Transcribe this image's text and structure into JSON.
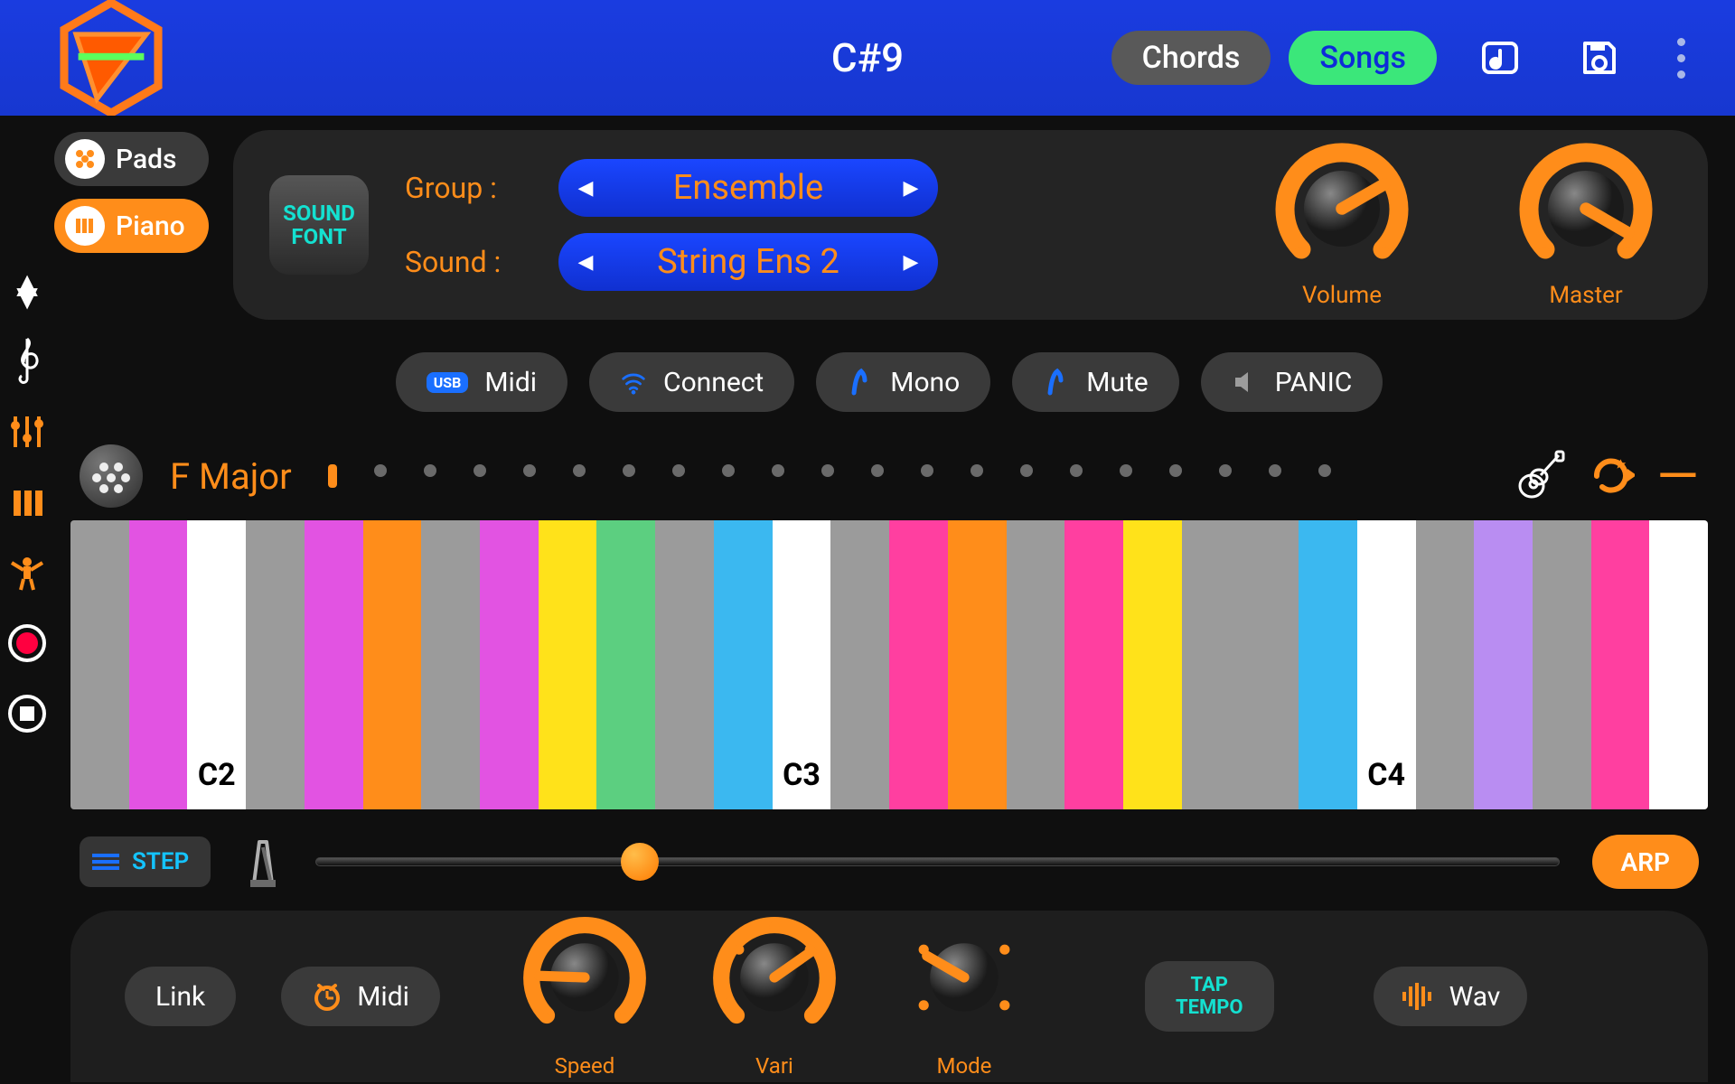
{
  "header": {
    "title": "C#9",
    "chords_label": "Chords",
    "songs_label": "Songs"
  },
  "instrument_tabs": {
    "pads": "Pads",
    "piano": "Piano"
  },
  "sound": {
    "font_button": "SOUND FONT",
    "group_label": "Group :",
    "group_value": "Ensemble",
    "sound_label": "Sound :",
    "sound_value": "String Ens 2",
    "volume_label": "Volume",
    "master_label": "Master",
    "volume_angle": 60,
    "master_angle": 120
  },
  "actions": {
    "midi": "Midi",
    "connect": "Connect",
    "mono": "Mono",
    "mute": "Mute",
    "panic": "PANIC"
  },
  "scale": {
    "name": "F Major",
    "dot_count": 21,
    "key_labels": {
      "2": "C2",
      "12": "C3",
      "22": "C4"
    },
    "key_colors": [
      "#9b9b9b",
      "#e253e2",
      "#ffffff",
      "#9b9b9b",
      "#e253e2",
      "#ff8d1a",
      "#9b9b9b",
      "#e253e2",
      "#ffe21a",
      "#5ccf80",
      "#9b9b9b",
      "#3bb8f0",
      "#ffffff",
      "#9b9b9b",
      "#ff3fa0",
      "#ff8d1a",
      "#9b9b9b",
      "#ff3fa0",
      "#ffe21a",
      "#9b9b9b",
      "#9b9b9b",
      "#3bb8f0",
      "#ffffff",
      "#9b9b9b",
      "#b98df2",
      "#9b9b9b",
      "#ff3fa0",
      "#ffffff"
    ]
  },
  "transport": {
    "step_label": "STEP",
    "arp_label": "ARP",
    "slider_pct": 26
  },
  "bottom": {
    "link": "Link",
    "midi": "Midi",
    "speed_label": "Speed",
    "vari_label": "Vari",
    "mode_label": "Mode",
    "tap_label_1": "TAP",
    "tap_label_2": "TEMPO",
    "wav_label": "Wav",
    "speed_angle": -88,
    "vari_angle": 55,
    "mode_angle": -60
  }
}
